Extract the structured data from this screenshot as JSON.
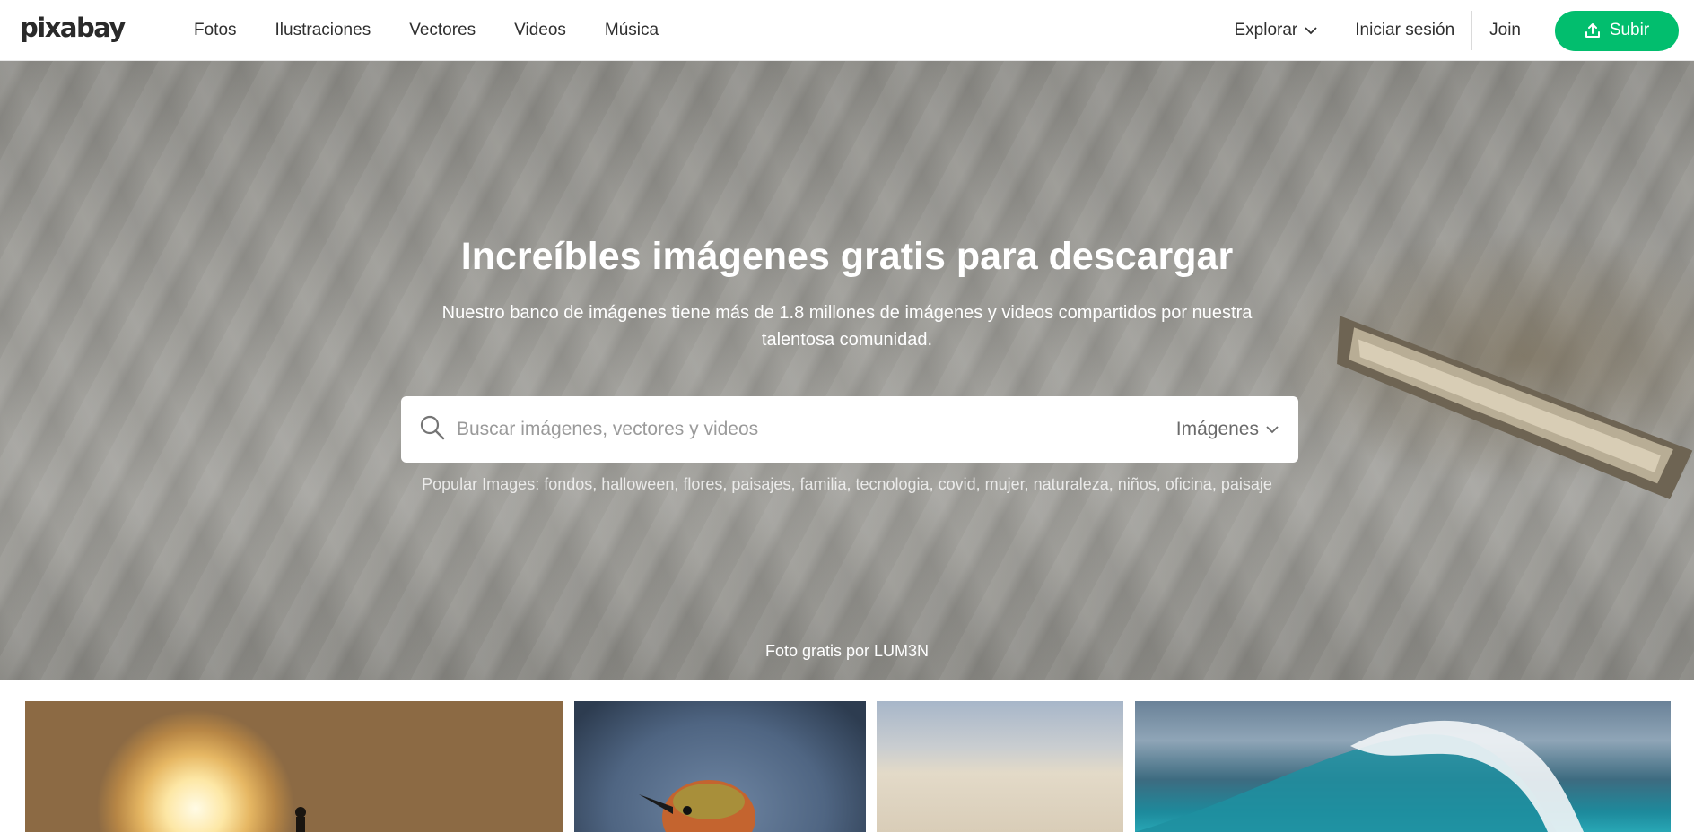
{
  "header": {
    "logo": "pixabay",
    "nav": [
      "Fotos",
      "Ilustraciones",
      "Vectores",
      "Videos",
      "Música"
    ],
    "explore_label": "Explorar",
    "login_label": "Iniciar sesión",
    "join_label": "Join",
    "upload_label": "Subir"
  },
  "hero": {
    "title": "Increíbles imágenes gratis para descargar",
    "subtitle": "Nuestro banco de imágenes tiene más de 1.8 millones de imágenes y videos compartidos por nuestra talentosa comunidad.",
    "search_placeholder": "Buscar imágenes, vectores y videos",
    "search_type": "Imágenes",
    "popular_prefix": "Popular Images:",
    "popular_tags": [
      "fondos",
      "halloween",
      "flores",
      "paisajes",
      "familia",
      "tecnologia",
      "covid",
      "mujer",
      "naturaleza",
      "niños",
      "oficina",
      "paisaje"
    ],
    "credit_prefix": "Foto gratis por",
    "credit_author": "LUM3N"
  },
  "colors": {
    "accent": "#02be6e"
  },
  "icons": {
    "upload": "upload-icon",
    "search": "search-icon",
    "chevron": "chevron-down-icon"
  }
}
